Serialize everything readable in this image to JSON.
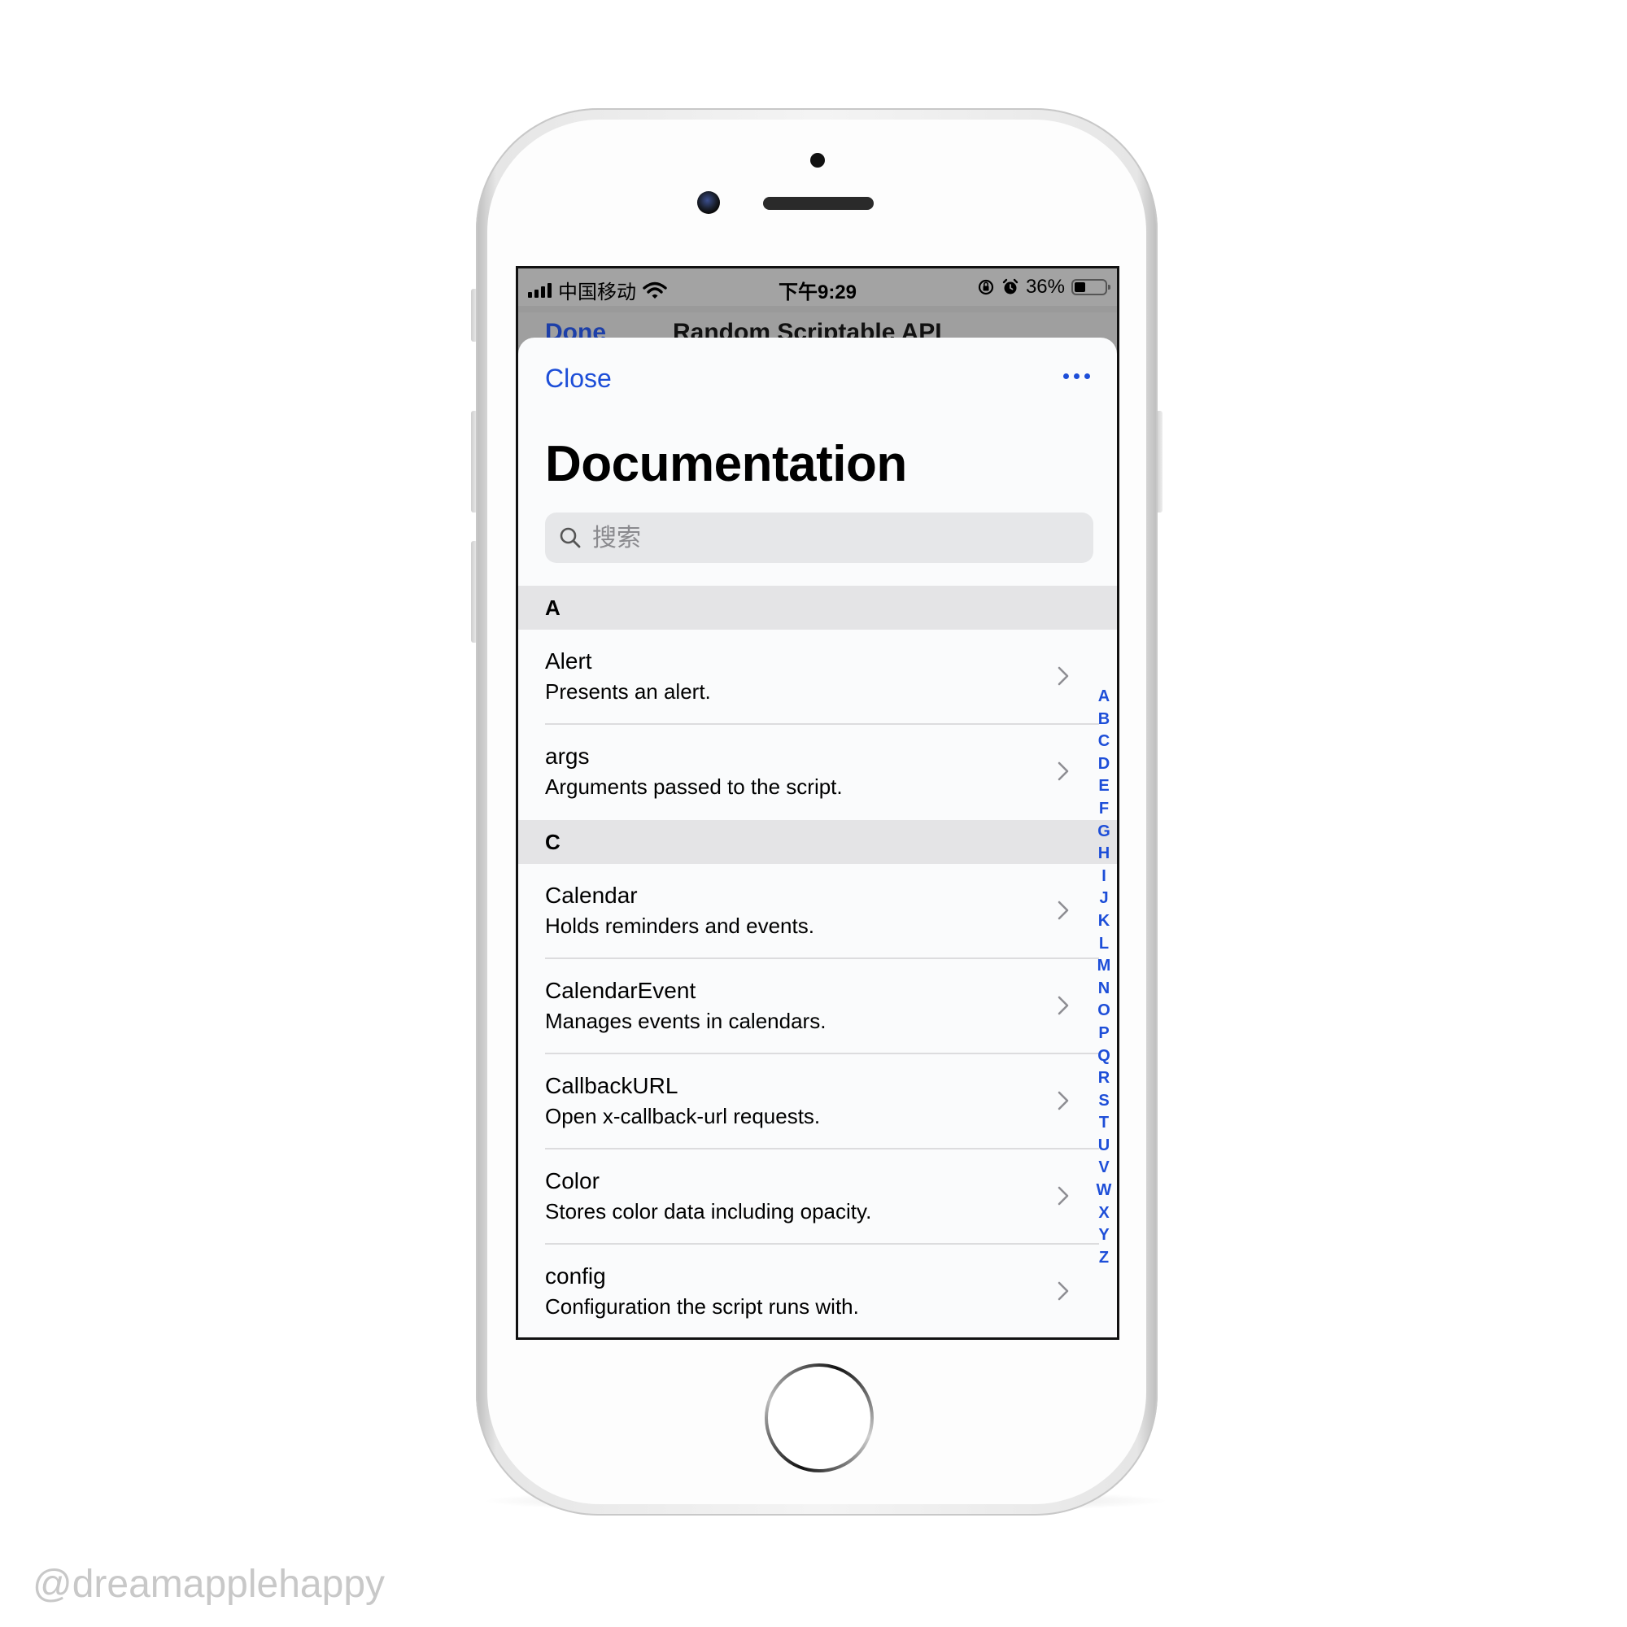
{
  "status_bar": {
    "carrier": "中国移动",
    "time": "下午9:29",
    "battery": "36%",
    "battery_level": 0.36,
    "icons": [
      "signal-icon",
      "wifi-icon",
      "orientation-lock-icon",
      "alarm-icon",
      "battery-icon"
    ]
  },
  "behind_nav": {
    "done_label": "Done",
    "title": "Random Scriptable API"
  },
  "nav": {
    "close_label": "Close",
    "more_icon": "ellipsis-icon"
  },
  "page": {
    "title": "Documentation"
  },
  "search": {
    "placeholder": "搜索",
    "value": ""
  },
  "sections": [
    {
      "letter": "A",
      "items": [
        {
          "title": "Alert",
          "subtitle": "Presents an alert."
        },
        {
          "title": "args",
          "subtitle": "Arguments passed to the script."
        }
      ]
    },
    {
      "letter": "C",
      "items": [
        {
          "title": "Calendar",
          "subtitle": "Holds reminders and events."
        },
        {
          "title": "CalendarEvent",
          "subtitle": "Manages events in calendars."
        },
        {
          "title": "CallbackURL",
          "subtitle": "Open x-callback-url requests."
        },
        {
          "title": "Color",
          "subtitle": "Stores color data including opacity."
        },
        {
          "title": "config",
          "subtitle": "Configuration the script runs with."
        }
      ]
    }
  ],
  "index_letters": [
    "A",
    "B",
    "C",
    "D",
    "E",
    "F",
    "G",
    "H",
    "I",
    "J",
    "K",
    "L",
    "M",
    "N",
    "O",
    "P",
    "Q",
    "R",
    "S",
    "T",
    "U",
    "V",
    "W",
    "X",
    "Y",
    "Z"
  ],
  "watermark": "@dreamapplehappy",
  "colors": {
    "accent": "#1d4ed8",
    "section_bg": "#e4e4e6",
    "search_bg": "#e6e7e9"
  }
}
